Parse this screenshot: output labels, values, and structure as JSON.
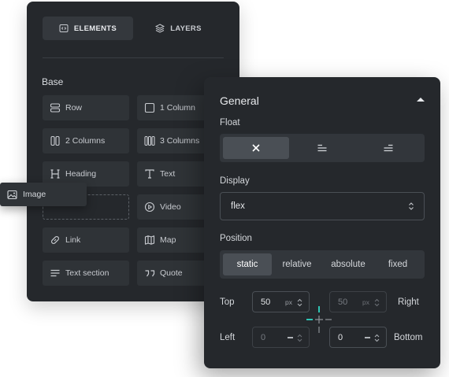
{
  "elements_panel": {
    "tabs": [
      {
        "label": "ELEMENTS",
        "icon": "code-icon",
        "active": true
      },
      {
        "label": "LAYERS",
        "icon": "layers-icon",
        "active": false
      }
    ],
    "section_title": "Base",
    "items": [
      {
        "label": "Row",
        "icon": "row-icon"
      },
      {
        "label": "1 Column",
        "icon": "square-icon"
      },
      {
        "label": "2 Columns",
        "icon": "two-columns-icon"
      },
      {
        "label": "3 Columns",
        "icon": "three-columns-icon"
      },
      {
        "label": "Heading",
        "icon": "heading-icon"
      },
      {
        "label": "Text",
        "icon": "text-icon"
      },
      {
        "label": "Video",
        "icon": "play-icon"
      },
      {
        "label": "Link",
        "icon": "link-icon"
      },
      {
        "label": "Map",
        "icon": "map-icon"
      },
      {
        "label": "Text section",
        "icon": "text-section-icon"
      },
      {
        "label": "Quote",
        "icon": "quote-icon"
      }
    ],
    "dragged_item": {
      "label": "Image",
      "icon": "image-icon"
    }
  },
  "general_panel": {
    "title": "General",
    "float": {
      "label": "Float",
      "options": [
        {
          "icon": "close-icon",
          "active": true
        },
        {
          "icon": "align-left-icon",
          "active": false
        },
        {
          "icon": "align-right-icon",
          "active": false
        }
      ]
    },
    "display": {
      "label": "Display",
      "value": "flex"
    },
    "position": {
      "label": "Position",
      "options": [
        {
          "label": "static",
          "active": true
        },
        {
          "label": "relative",
          "active": false
        },
        {
          "label": "absolute",
          "active": false
        },
        {
          "label": "fixed",
          "active": false
        }
      ]
    },
    "offsets": {
      "top": {
        "label": "Top",
        "value": "50",
        "unit": "px"
      },
      "right": {
        "label": "Right",
        "value": "50",
        "unit": "px"
      },
      "left": {
        "label": "Left",
        "value": "0"
      },
      "bottom": {
        "label": "Bottom",
        "value": "0"
      }
    }
  },
  "colors": {
    "panel_bg": "#25282c",
    "button_bg": "#2f3337",
    "active_bg": "#4a4f55",
    "accent": "#2fc4b4"
  }
}
